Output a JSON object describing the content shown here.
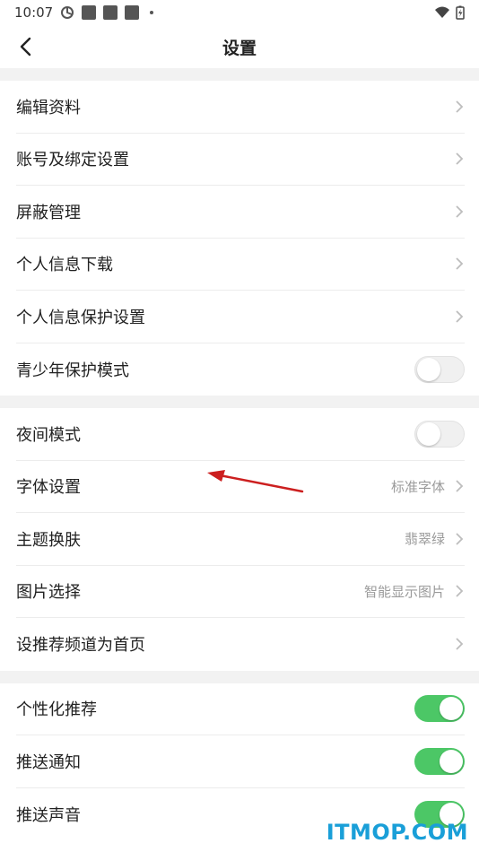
{
  "status_bar": {
    "time": "10:07"
  },
  "header": {
    "title": "设置"
  },
  "groups": [
    {
      "items": [
        {
          "label": "编辑资料",
          "type": "link"
        },
        {
          "label": "账号及绑定设置",
          "type": "link"
        },
        {
          "label": "屏蔽管理",
          "type": "link"
        },
        {
          "label": "个人信息下载",
          "type": "link"
        },
        {
          "label": "个人信息保护设置",
          "type": "link"
        },
        {
          "label": "青少年保护模式",
          "type": "toggle",
          "on": false
        }
      ]
    },
    {
      "items": [
        {
          "label": "夜间模式",
          "type": "toggle",
          "on": false
        },
        {
          "label": "字体设置",
          "value": "标准字体",
          "type": "link"
        },
        {
          "label": "主题换肤",
          "value": "翡翠绿",
          "type": "link"
        },
        {
          "label": "图片选择",
          "value": "智能显示图片",
          "type": "link"
        },
        {
          "label": "设推荐频道为首页",
          "type": "link"
        }
      ]
    },
    {
      "items": [
        {
          "label": "个性化推荐",
          "type": "toggle",
          "on": true
        },
        {
          "label": "推送通知",
          "type": "toggle",
          "on": true
        },
        {
          "label": "推送声音",
          "type": "toggle",
          "on": true
        }
      ]
    }
  ],
  "watermark": "ITMOP.COM",
  "colors": {
    "toggle_on": "#4cc766",
    "watermark": "#1a9fd8",
    "arrow": "#cc1f1f"
  }
}
